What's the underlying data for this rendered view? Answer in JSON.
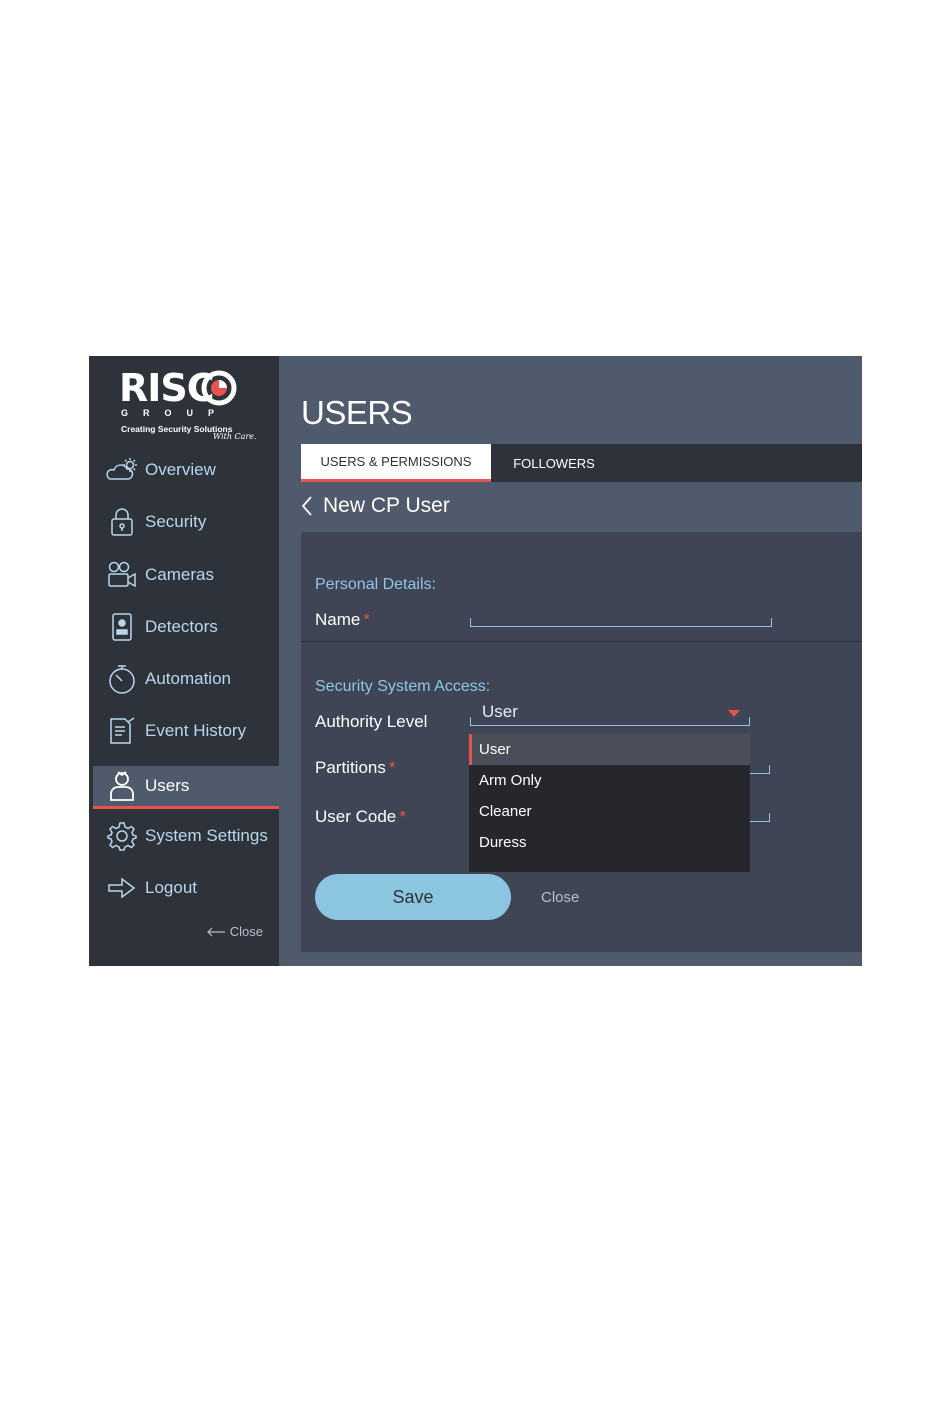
{
  "brand": {
    "name": "RISC",
    "group": "GROUP",
    "tagline": "Creating Security Solutions",
    "tagline_script": "With Care."
  },
  "sidebar": {
    "items": [
      {
        "label": "Overview",
        "icon": "cloud-sun-icon"
      },
      {
        "label": "Security",
        "icon": "lock-icon"
      },
      {
        "label": "Cameras",
        "icon": "camera-icon"
      },
      {
        "label": "Detectors",
        "icon": "detector-icon"
      },
      {
        "label": "Automation",
        "icon": "clock-icon"
      },
      {
        "label": "Event History",
        "icon": "document-icon"
      },
      {
        "label": "Users",
        "icon": "user-icon",
        "active": true
      },
      {
        "label": "System Settings",
        "icon": "gear-icon"
      },
      {
        "label": "Logout",
        "icon": "logout-icon"
      }
    ],
    "close_label": "Close"
  },
  "header": {
    "title": "USERS"
  },
  "tabs": [
    {
      "label": "USERS & PERMISSIONS",
      "active": true
    },
    {
      "label": "FOLLOWERS",
      "active": false
    }
  ],
  "subheader": {
    "title": "New CP User"
  },
  "form": {
    "personal_section": "Personal Details:",
    "name_label": "Name",
    "name_value": "",
    "security_section": "Security System Access:",
    "authority_label": "Authority Level",
    "authority_value": "User",
    "authority_options": [
      "User",
      "Arm Only",
      "Cleaner",
      "Duress"
    ],
    "partitions_label": "Partitions",
    "user_code_label": "User Code",
    "required_mark": "*",
    "save_label": "Save",
    "close_label": "Close"
  },
  "colors": {
    "accent": "#e8524f",
    "link": "#8fc6e6",
    "sidebar_bg": "#2e323b",
    "main_bg": "#4f5a6c",
    "button": "#8cc5e0"
  }
}
